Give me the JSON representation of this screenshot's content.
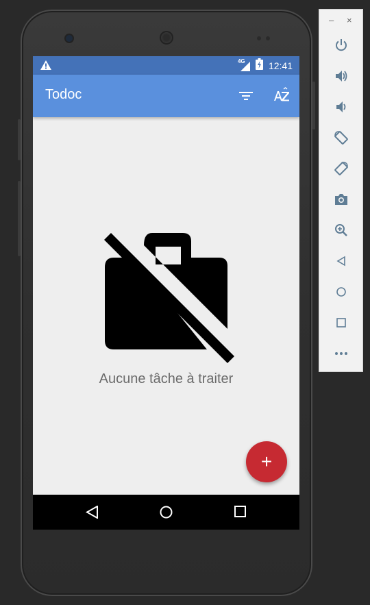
{
  "status_bar": {
    "warning_icon": "warning-icon",
    "network_label": "4G",
    "time": "12:41"
  },
  "app_bar": {
    "title": "Todoc",
    "actions": [
      "filter-icon",
      "sort-alpha-icon"
    ],
    "sort_label": "AZ"
  },
  "empty_state": {
    "icon": "work-off-icon",
    "message": "Aucune tâche à traiter"
  },
  "fab": {
    "icon": "add-icon",
    "label": "+"
  },
  "nav_bar": {
    "buttons": [
      "back-icon",
      "home-icon",
      "recents-icon"
    ]
  },
  "emulator_toolbar": {
    "minimize_label": "–",
    "close_label": "×",
    "tools": [
      "power-icon",
      "volume-up-icon",
      "volume-down-icon",
      "rotate-left-icon",
      "rotate-right-icon",
      "camera-icon",
      "zoom-icon",
      "back-icon",
      "home-icon",
      "overview-icon",
      "more-icon"
    ]
  },
  "colors": {
    "status_bar": "#4472b8",
    "app_bar": "#5a90dd",
    "fab": "#c62a32",
    "screen_bg": "#eeeeee"
  }
}
